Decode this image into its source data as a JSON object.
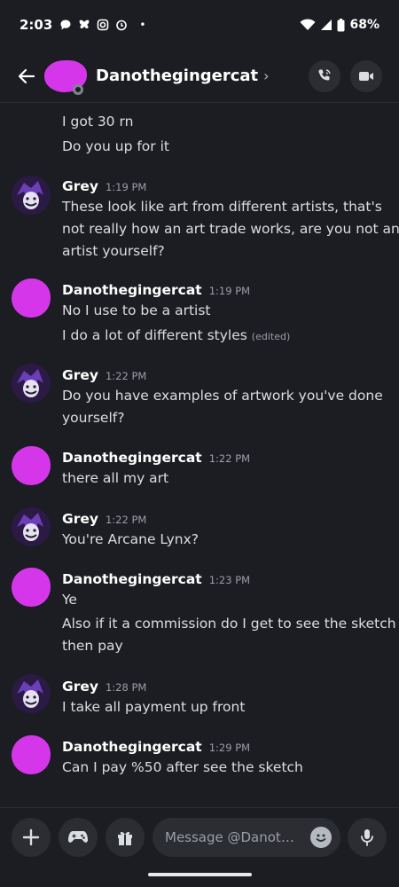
{
  "status_bar": {
    "time": "2:03",
    "battery": "68%",
    "dot": "•"
  },
  "header": {
    "contact_name": "Danothegingercat",
    "chevron": "›"
  },
  "messages": [
    {
      "lines": [
        "I got 30 rn",
        "Do you up for it"
      ]
    },
    {
      "author": "Grey",
      "time": "1:19 PM",
      "lines": [
        "These look like art from different artists, that's",
        "not really how an art trade works, are you not an",
        "artist yourself?"
      ]
    },
    {
      "author": "Danothegingercat",
      "time": "1:19 PM",
      "lines": [
        "No I use to be a artist",
        "I do a lot of different styles"
      ],
      "edited": "(edited)"
    },
    {
      "author": "Grey",
      "time": "1:22 PM",
      "lines": [
        "Do you have examples of artwork you've done",
        "yourself?"
      ]
    },
    {
      "author": "Danothegingercat",
      "time": "1:22 PM",
      "lines": [
        "there all my art"
      ]
    },
    {
      "author": "Grey",
      "time": "1:22 PM",
      "lines": [
        "You're Arcane Lynx?"
      ]
    },
    {
      "author": "Danothegingercat",
      "time": "1:23 PM",
      "lines": [
        "Ye",
        "Also if it a commission do I get to see the sketch",
        "then pay"
      ]
    },
    {
      "author": "Grey",
      "time": "1:28 PM",
      "lines": [
        "I take all payment up front"
      ]
    },
    {
      "author": "Danothegingercat",
      "time": "1:29 PM",
      "lines": [
        "Can I pay %50 after see the sketch"
      ]
    }
  ],
  "composer": {
    "placeholder": "Message @Danot…"
  },
  "icons": {
    "status_bar": [
      "message-icon",
      "butterfly-icon",
      "instagram-icon",
      "alarm-icon",
      "wifi-icon",
      "signal-icon",
      "battery-icon"
    ],
    "header": [
      "back-arrow-icon",
      "voice-call-icon",
      "video-call-icon"
    ],
    "composer": [
      "plus-icon",
      "gamepad-icon",
      "gift-icon",
      "emoji-icon",
      "microphone-icon"
    ]
  },
  "colors": {
    "background": "#1c1d22",
    "surface": "#2b2d33",
    "avatar_scribble": "#d636ea",
    "grey_avatar": "#6a3fb8",
    "text": "#dbdee1",
    "muted": "#9a9ea6"
  }
}
